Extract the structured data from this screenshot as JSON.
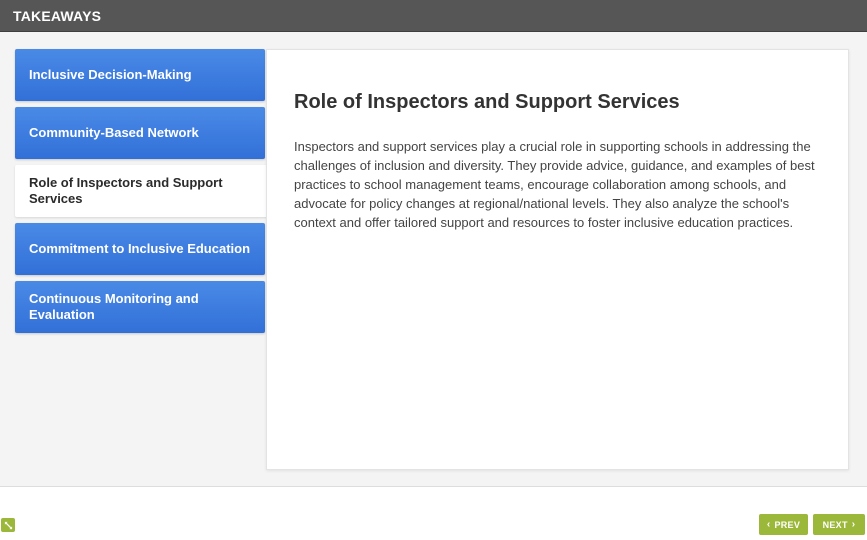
{
  "header": {
    "title": "TAKEAWAYS"
  },
  "tabs": [
    {
      "label": "Inclusive Decision-Making",
      "active": false
    },
    {
      "label": "Community-Based Network",
      "active": false
    },
    {
      "label": "Role of Inspectors and Support Services",
      "active": true
    },
    {
      "label": "Commitment to Inclusive Education",
      "active": false
    },
    {
      "label": "Continuous Monitoring and Evaluation",
      "active": false
    }
  ],
  "content": {
    "heading": "Role of Inspectors and Support Services",
    "body": "Inspectors and support services play a crucial role in supporting schools in addressing the challenges of inclusion and diversity. They provide advice, guidance, and examples of best practices to school management teams, encourage collaboration among schools, and advocate for policy changes at regional/national levels. They also analyze the school's context and offer tailored support and resources to foster inclusive education practices."
  },
  "footer": {
    "prev_label": "PREV",
    "next_label": "NEXT",
    "expand_icon": "expand-icon"
  },
  "colors": {
    "header_bg": "#565656",
    "tab_blue": "#3a7be0",
    "nav_green": "#9cb83b"
  }
}
